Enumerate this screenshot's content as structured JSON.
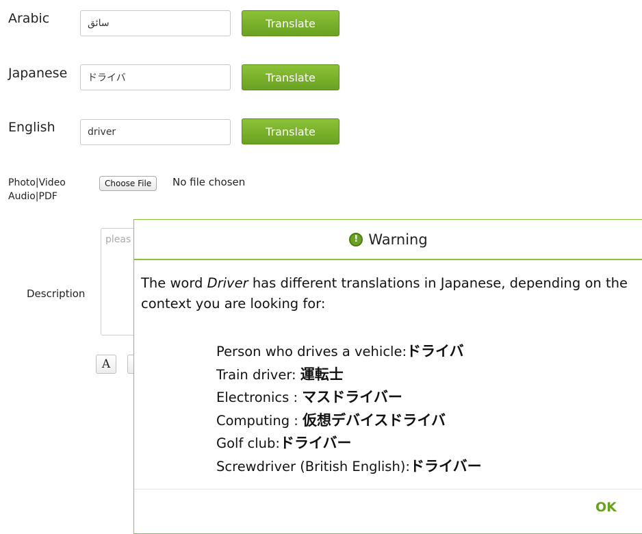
{
  "translate_rows": [
    {
      "language": "Arabic",
      "value": "سائق",
      "button": "Translate"
    },
    {
      "language": "Japanese",
      "value": "ドライバ",
      "button": "Translate"
    },
    {
      "language": "English",
      "value": "driver",
      "button": "Translate"
    }
  ],
  "media": {
    "label_line1": "Photo|Video",
    "label_line2": "Audio|PDF",
    "choose_button": "Choose File",
    "status": "No file chosen"
  },
  "description": {
    "label": "Description",
    "placeholder": "pleas"
  },
  "toolbar": {
    "font_button": "A"
  },
  "dialog": {
    "title": "Warning",
    "icon": "exclamation-icon",
    "message_before": "The word ",
    "message_word": "Driver",
    "message_after": " has different translations in Japanese, depending on the context you are looking for:",
    "contexts": [
      {
        "label": "Person who drives a vehicle:",
        "term": "ドライバ"
      },
      {
        "label": "Train driver: ",
        "term": "運転士"
      },
      {
        "label": "Electronics : ",
        "term": "マスドライバー"
      },
      {
        "label": "Computing : ",
        "term": "仮想デバイスドライバ"
      },
      {
        "label": "Golf club:",
        "term": "ドライバー"
      },
      {
        "label": "Screwdriver (British English):",
        "term": "ドライバー"
      }
    ],
    "ok_label": "OK"
  },
  "colors": {
    "accent_green": "#8cc238",
    "button_green": "#6aa122"
  }
}
